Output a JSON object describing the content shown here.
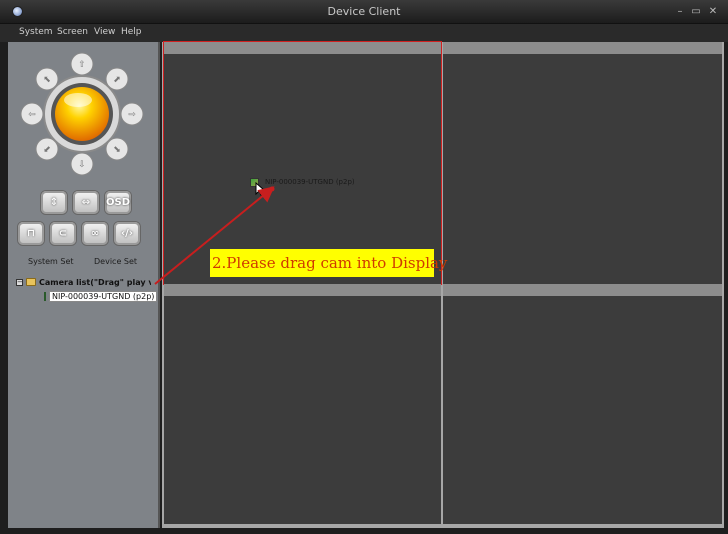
{
  "window": {
    "title": "Device Client",
    "min_glyph": "–",
    "max_glyph": "▭",
    "close_glyph": "✕"
  },
  "menu": [
    "System",
    "Screen",
    "View",
    "Help"
  ],
  "left_panel": {
    "buttons_row1": [
      "⇕",
      "⇔",
      "OSD"
    ],
    "buttons_row2": [
      "⊓",
      "⊂",
      "∞",
      "‹/›"
    ],
    "system_set": "System Set",
    "device_set": "Device Set",
    "tree": {
      "root_label": "Camera list(\"Drag\" play vi",
      "expander": "−",
      "camera": "NIP-000039-UTGND (p2p)"
    }
  },
  "display": {
    "dragged_camera": "NIP-000039-UTGND (p2p)",
    "callout": "2.Please drag cam into Display"
  },
  "colors": {
    "accent_red": "#d02020",
    "callout_bg": "#ffff00",
    "callout_text": "#d03a00"
  },
  "icons": [
    "app-icon",
    "ptz-joystick-icon",
    "folder-icon",
    "camera-icon",
    "cursor-icon"
  ]
}
